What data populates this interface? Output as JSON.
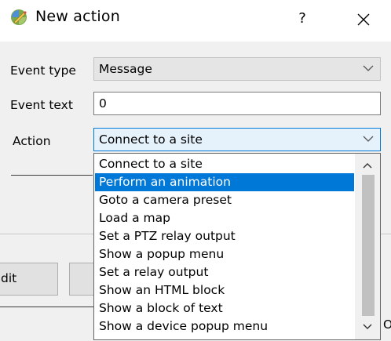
{
  "window": {
    "title": "New action",
    "help_label": "?",
    "close_label": "✕",
    "icon": "animation-app-icon"
  },
  "form": {
    "event_type_label": "Event type",
    "event_type_value": "Message",
    "event_text_label": "Event text",
    "event_text_value": "0",
    "action_label": "Action",
    "action_value": "Connect to a site"
  },
  "buttons": {
    "edit_partial": "dit",
    "ok_partial": "OK"
  },
  "dropdown": {
    "selected_index": 1,
    "options": [
      "Connect to a site",
      "Perform an animation",
      "Goto a camera preset",
      "Load a map",
      "Set a PTZ relay output",
      "Show a popup menu",
      "Set a relay output",
      "Show an HTML block",
      "Show a block of text",
      "Show a device popup menu"
    ]
  },
  "colors": {
    "selection": "#0078d7",
    "focus_border": "#0078d7",
    "dialog_bg": "#f0f0f0"
  }
}
